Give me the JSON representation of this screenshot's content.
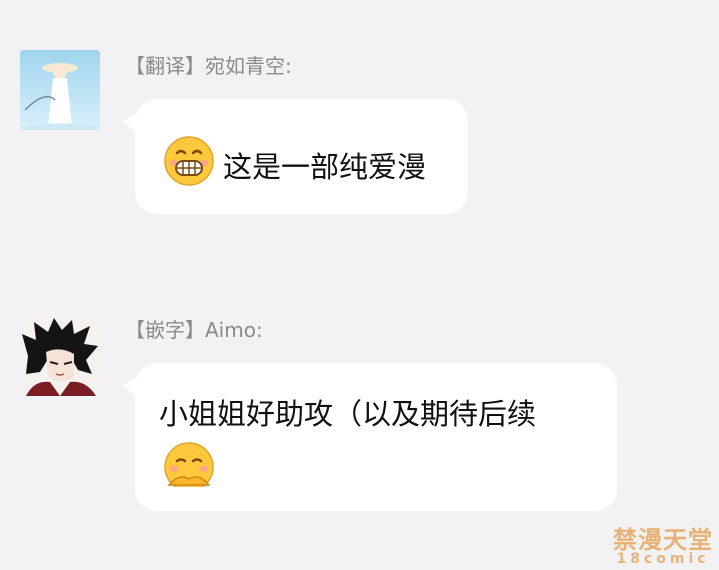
{
  "messages": [
    {
      "sender": "【翻译】宛如青空:",
      "text": "这是一部纯爱漫",
      "emoji": "grinning-face-emoji",
      "avatar": "girl-with-hat-avatar"
    },
    {
      "sender": "【嵌字】Aimo:",
      "text": "小姐姐好助攻（以及期待后续",
      "emoji": "hand-over-mouth-emoji",
      "avatar": "black-haired-boy-avatar"
    }
  ],
  "watermark": {
    "line1": "禁漫天堂",
    "line2": "18comic"
  },
  "colors": {
    "background": "#f2f2f4",
    "bubble": "#ffffff",
    "sender_text": "#8a8a8a",
    "emoji_yellow": "#ffc83d"
  }
}
